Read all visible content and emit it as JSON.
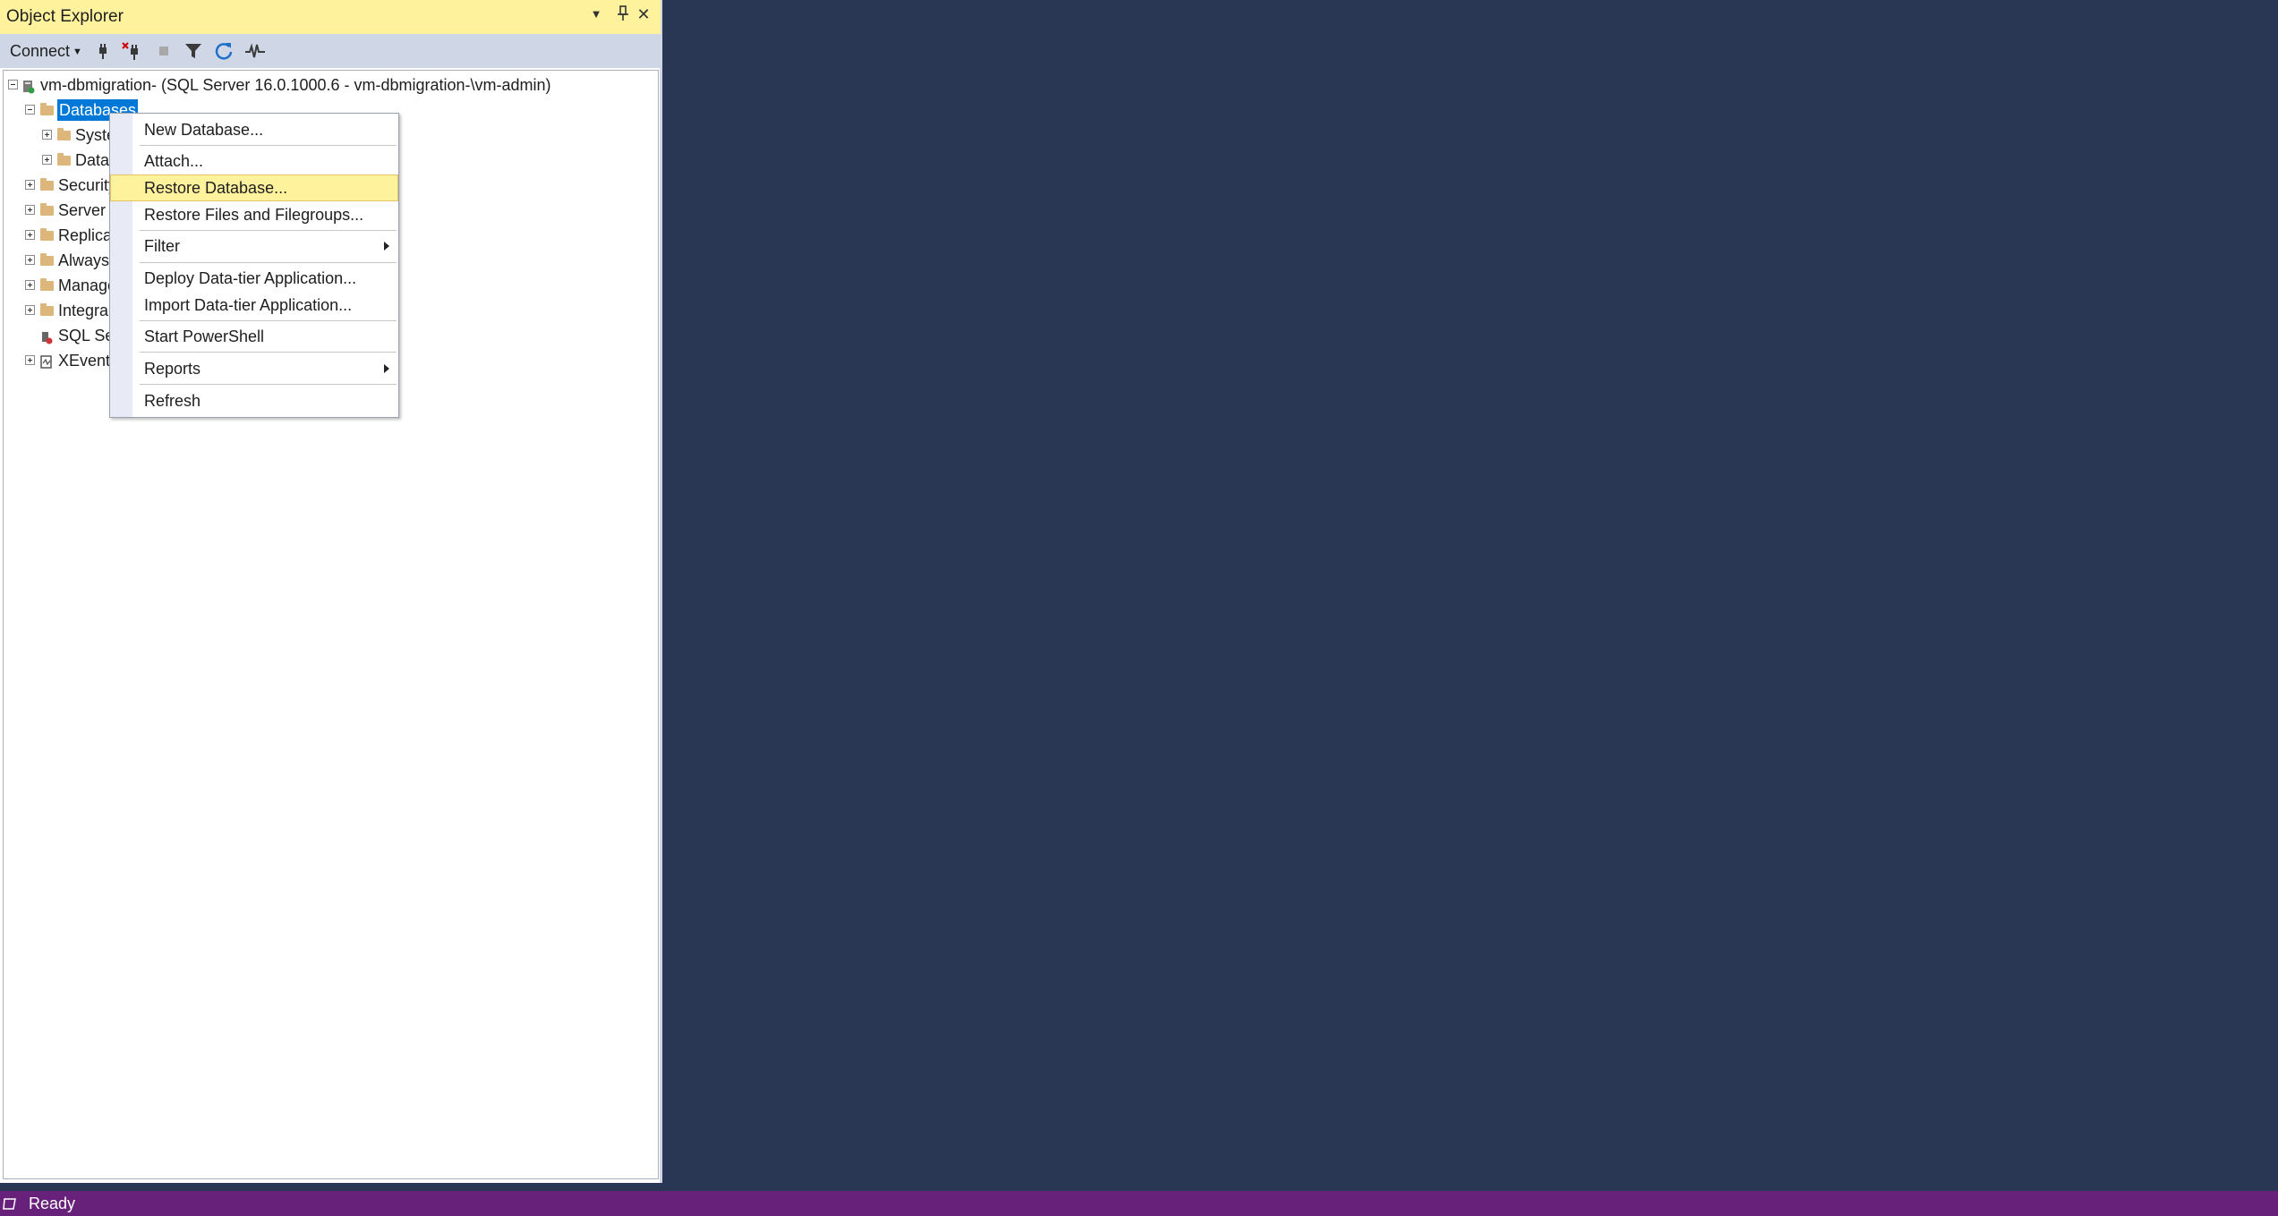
{
  "object_explorer": {
    "title": "Object Explorer",
    "toolbar": {
      "connect_label": "Connect"
    },
    "tree": {
      "server_label": "vm-dbmigration- (SQL Server 16.0.1000.6 - vm-dbmigration-\\vm-admin)",
      "items": [
        "Databases",
        "Syste",
        "Data",
        "Security",
        "Server (",
        "Replica",
        "Always",
        "Manage",
        "Integra",
        "SQL Se",
        "XEvent"
      ]
    }
  },
  "context_menu": {
    "items": [
      "New Database...",
      "Attach...",
      "Restore Database...",
      "Restore Files and Filegroups...",
      "Filter",
      "Deploy Data-tier Application...",
      "Import Data-tier Application...",
      "Start PowerShell",
      "Reports",
      "Refresh"
    ],
    "highlighted": "Restore Database..."
  },
  "status_bar": {
    "text": "Ready"
  },
  "colors": {
    "background": "#293754",
    "title_bar": "#fff29d",
    "toolbar": "#cfd6e5",
    "selection": "#0078d7",
    "status_bar": "#68217a"
  }
}
